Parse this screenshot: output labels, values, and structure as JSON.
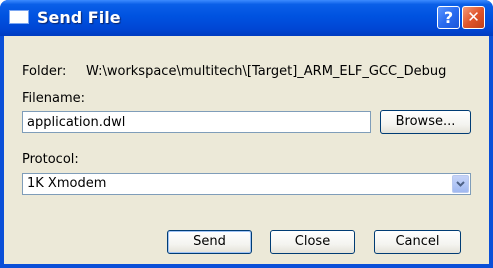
{
  "window": {
    "title": "Send File"
  },
  "titlebar": {
    "help_glyph": "?",
    "close_glyph": "✕",
    "icons": [
      "window-icon",
      "help-icon",
      "close-icon"
    ]
  },
  "folder": {
    "label": "Folder:",
    "value": "W:\\workspace\\multitech\\[Target]_ARM_ELF_GCC_Debug"
  },
  "filename": {
    "label": "Filename:",
    "value": "application.dwl",
    "browse_label": "Browse..."
  },
  "protocol": {
    "label": "Protocol:",
    "selected": "1K Xmodem"
  },
  "buttons": {
    "send": "Send",
    "close": "Close",
    "cancel": "Cancel"
  },
  "colors": {
    "titlebar": "#0052e0",
    "client": "#ece9d8",
    "close_button": "#e1552b",
    "field_border": "#7f9db9"
  }
}
